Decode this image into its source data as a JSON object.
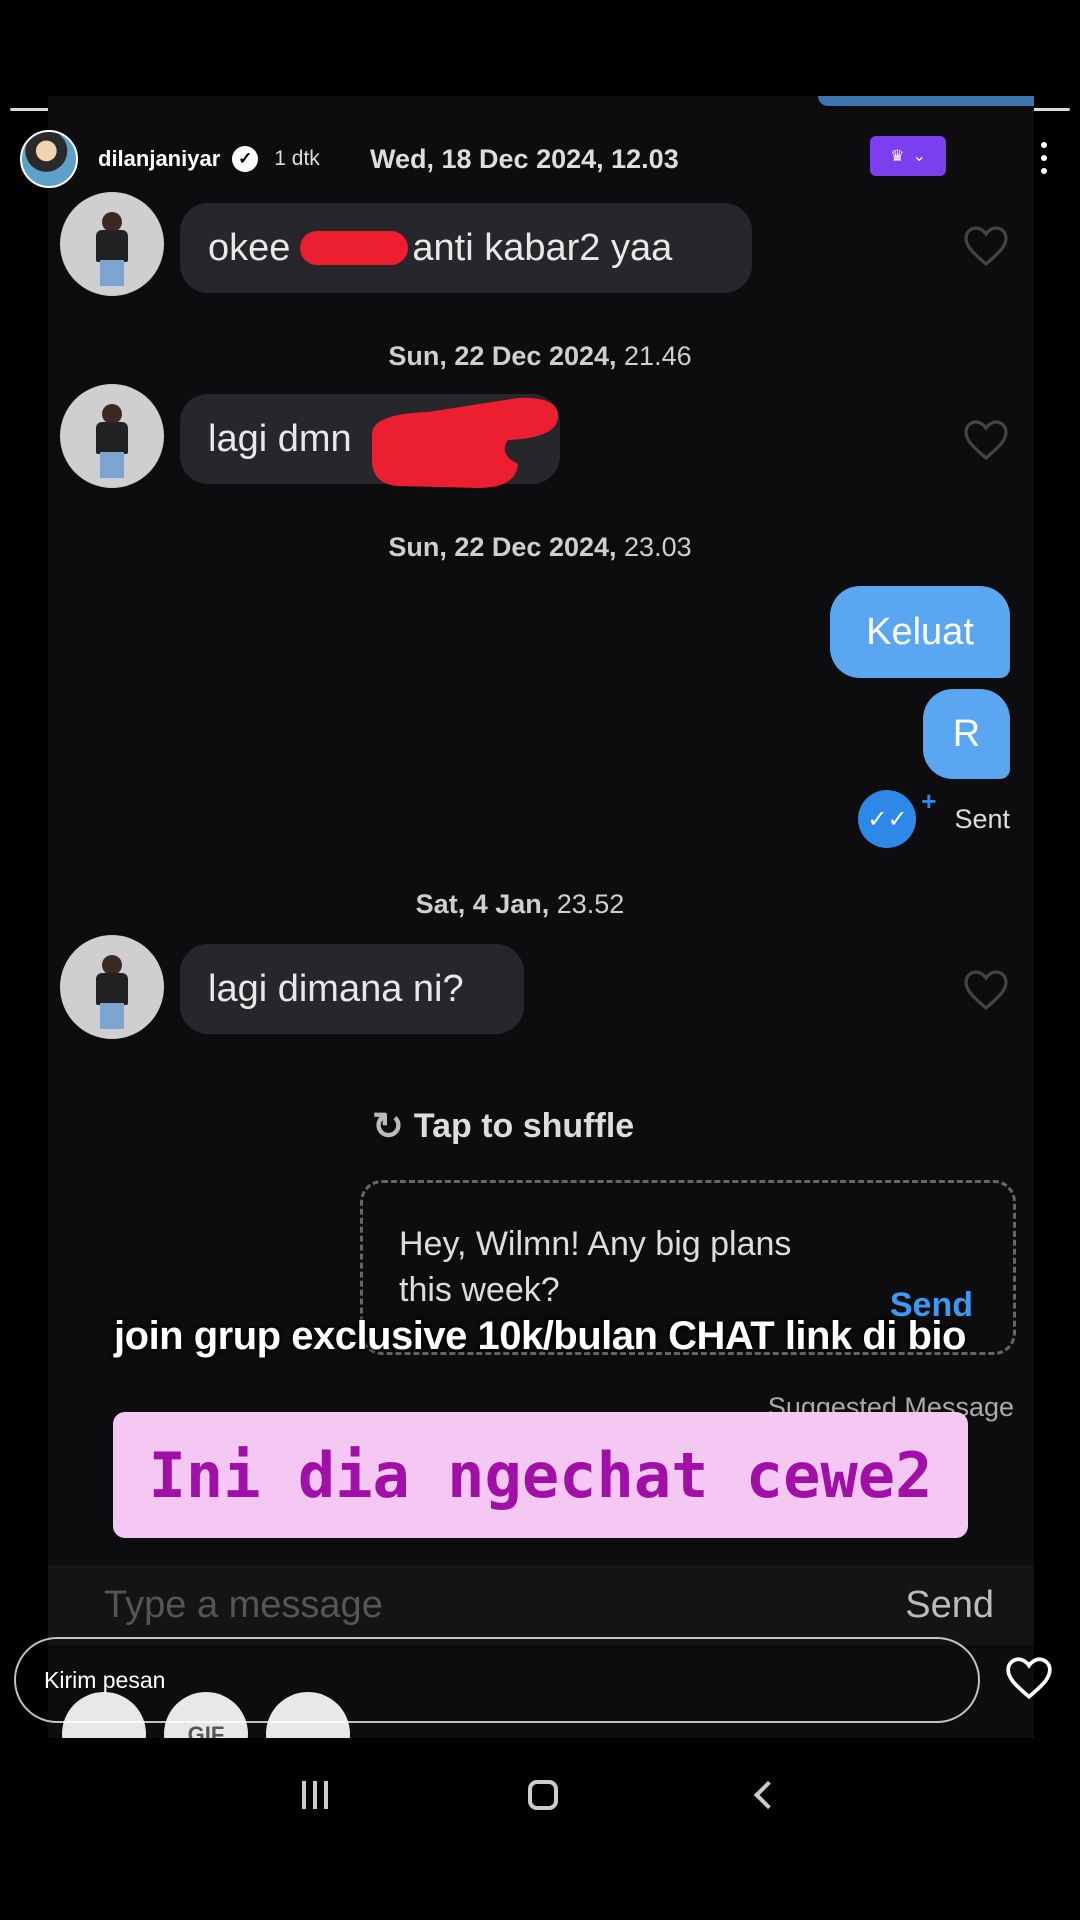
{
  "story": {
    "username": "dilanjaniyar",
    "time_ago": "1 dtk",
    "verified_mark": "✓",
    "header_date": "Wed, 18 Dec 2024, 12.03",
    "crown_icon": "♛",
    "dropdown_caret": "⌄"
  },
  "chat": {
    "messages": [
      {
        "pre": "okee",
        "post": "anti kabar2 yaa"
      },
      {
        "pre": "lagi dmn",
        "post": ""
      },
      {
        "pre": "lagi dimana ni?",
        "post": ""
      }
    ],
    "stamps": [
      {
        "date": "Sun, 22 Dec 2024,",
        "time": " 21.46"
      },
      {
        "date": "Sun, 22 Dec 2024,",
        "time": " 23.03"
      },
      {
        "date": "Sat, 4 Jan,",
        "time": " 23.52"
      }
    ],
    "outgoing": [
      "Keluat",
      "R"
    ],
    "sent_status": "Sent",
    "sent_icon": "✓✓",
    "sent_plus": "+"
  },
  "suggest": {
    "shuffle_icon": "↻",
    "shuffle_label": "Tap to shuffle",
    "text_line1": "Hey, Wilmn! Any big plans",
    "text_line2": "this week?",
    "send_label": "Send",
    "caption": "Suggested Message"
  },
  "overlay": {
    "caption": "join grup exclusive 10k/bulan CHAT link di bio",
    "sticker": "Ini dia ngechat cewe2"
  },
  "composer": {
    "placeholder": "Type a message",
    "send_label": "Send"
  },
  "reply": {
    "placeholder": "Kirim pesan"
  },
  "tray": [
    "",
    "GIF",
    ""
  ],
  "colors": {
    "accent_blue": "#5aa6f0",
    "sticker_bg": "#f5c8f3",
    "sticker_text": "#a010a6",
    "crown_purple": "#7b3ff0",
    "redaction_red": "#ec1f31"
  }
}
